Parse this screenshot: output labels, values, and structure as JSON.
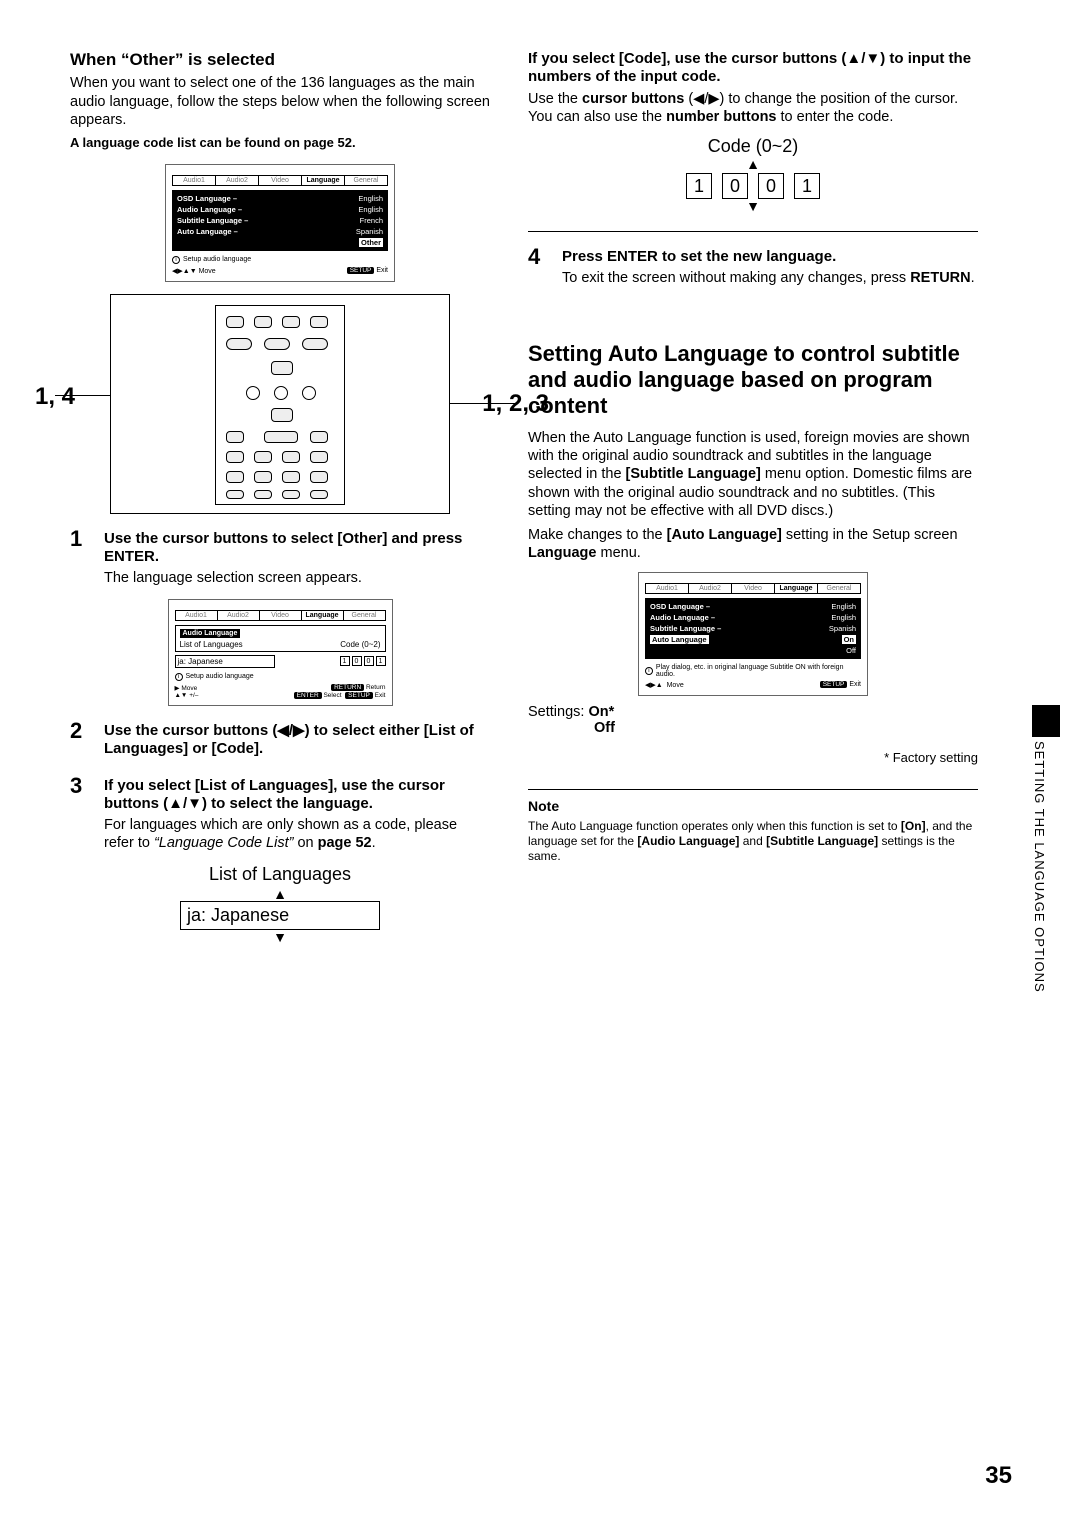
{
  "left": {
    "heading": "When “Other” is selected",
    "intro": "When you want to select one of the 136 languages as the main audio language, follow the steps below when the following screen appears.",
    "list_note": "A language code list can be found on page 52.",
    "screen1": {
      "tabs": [
        "Audio1",
        "Audio2",
        "Video",
        "Language",
        "General"
      ],
      "rows": [
        {
          "l": "OSD Language –",
          "v": "English"
        },
        {
          "l": "Audio Language –",
          "v": "English"
        },
        {
          "l": "Subtitle Language –",
          "v": "French"
        },
        {
          "l": "Auto Language –",
          "v": "Spanish"
        }
      ],
      "highlight": "Other",
      "info": "Setup audio language",
      "ctrl1": "Move",
      "ctrl2": "Exit",
      "pill": "SETUP"
    },
    "callout_left": "1, 4",
    "callout_right": "1, 2, 3",
    "step1_t": "Use the cursor buttons to select [Other] and press ENTER.",
    "step1_d": "The language selection screen appears.",
    "screen2": {
      "tabs": [
        "Audio1",
        "Audio2",
        "Video",
        "Language",
        "General"
      ],
      "title": "Audio Language",
      "sub1": "List of Languages",
      "code_label": "Code (0~2)",
      "sel_val": "ja: Japanese",
      "code": [
        "1",
        "0",
        "0",
        "1"
      ],
      "info": "Setup audio language",
      "left_ctrl": "Move",
      "left_ctrl2": "+/–",
      "mid_pill": "ENTER",
      "mid_txt": "Select",
      "right_pill": "RETURN",
      "right_txt": "Return",
      "setup_pill": "SETUP",
      "exit_txt": "Exit"
    },
    "step2_t": "Use the cursor buttons (◀/▶) to select either [List of Languages] or [Code].",
    "step3_t": "If you select [List of Languages], use the cursor buttons (▲/▼) to select the language.",
    "step3_d1": "For languages which are only shown as a code, please refer to ",
    "step3_d2": "“Language Code List”",
    "step3_d3": " on ",
    "step3_d4": "page 52",
    "step3_d5": ".",
    "list_diag_label": "List of Languages",
    "list_diag_val": "ja: Japanese"
  },
  "right": {
    "code_heading": "If you select [Code], use the cursor buttons (▲/▼) to input the numbers of the input code.",
    "code_desc_a": "Use the ",
    "code_desc_b": "cursor buttons",
    "code_desc_c": " (◀/▶) to change the position of the cursor. You can also use the ",
    "code_desc_d": "number buttons",
    "code_desc_e": " to enter the code.",
    "code_label": "Code (0~2)",
    "code": [
      "1",
      "0",
      "0",
      "1"
    ],
    "step4_t": "Press ENTER to set the new language.",
    "step4_d1": "To exit the screen without making any changes, press ",
    "step4_d2": "RETURN",
    "step4_d3": ".",
    "big_heading": "Setting Auto Language to control subtitle and audio language based on program content",
    "big_p1a": "When the Auto Language function is used, foreign movies are shown with the original audio soundtrack and subtitles in the language selected in the ",
    "big_p1b": "[Subtitle Language]",
    "big_p1c": " menu option. Domestic films are shown with the original audio soundtrack and no subtitles. (This setting may not be effective with all DVD discs.)",
    "big_p2a": "Make changes to the ",
    "big_p2b": "[Auto Language]",
    "big_p2c": " setting in the Setup screen ",
    "big_p2d": "Language",
    "big_p2e": " menu.",
    "screen3": {
      "tabs": [
        "Audio1",
        "Audio2",
        "Video",
        "Language",
        "General"
      ],
      "rows": [
        {
          "l": "OSD Language –",
          "v": "English"
        },
        {
          "l": "Audio Language –",
          "v": "English"
        },
        {
          "l": "Subtitle Language –",
          "v": "Spanish"
        }
      ],
      "hl_l": "Auto Language",
      "hl_v1": "On",
      "hl_v2": "Off",
      "info": "Play dialog, etc. in original language Subtitle ON with foreign audio.",
      "ctrl1": "Move",
      "pill": "SETUP",
      "exit": "Exit"
    },
    "settings_label": "Settings:",
    "settings_on": "On*",
    "settings_off": "Off",
    "factory": "* Factory setting",
    "note_label": "Note",
    "note_a": "The Auto Language function operates only when this function is set to ",
    "note_b": "[On]",
    "note_c": ", and the language set for the ",
    "note_d": "[Audio Language]",
    "note_e": " and ",
    "note_f": "[Subtitle Language]",
    "note_g": " settings is the same."
  },
  "side_label": "SETTING THE LANGUAGE OPTIONS",
  "page": "35"
}
